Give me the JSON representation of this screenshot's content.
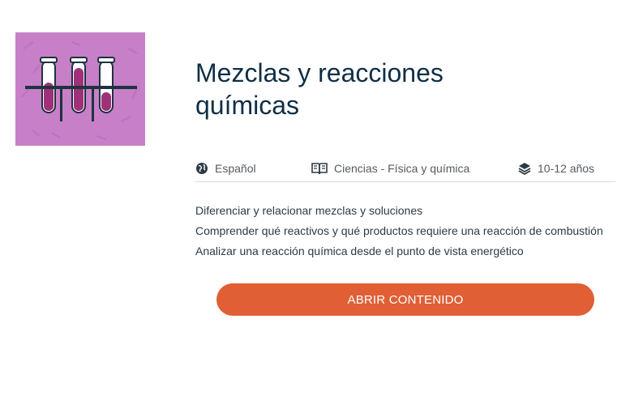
{
  "card": {
    "title": "Mezclas y reacciones químicas",
    "thumbnail_icon": "test-tubes-icon",
    "thumbnail_bg": "#c77fc8",
    "meta": {
      "language": {
        "icon": "globe-icon",
        "label": "Español"
      },
      "subject": {
        "icon": "open-book-icon",
        "label": "Ciencias - Física y química"
      },
      "age": {
        "icon": "layers-icon",
        "label": "10-12 años"
      }
    },
    "objectives": [
      "Diferenciar y relacionar mezclas y soluciones",
      "Comprender qué reactivos y qué productos requiere una reacción de combustión",
      "Analizar una reacción química desde el punto de vista energético"
    ],
    "cta_label": "ABRIR CONTENIDO",
    "cta_color": "#e05f35",
    "title_color": "#0f2f46"
  }
}
